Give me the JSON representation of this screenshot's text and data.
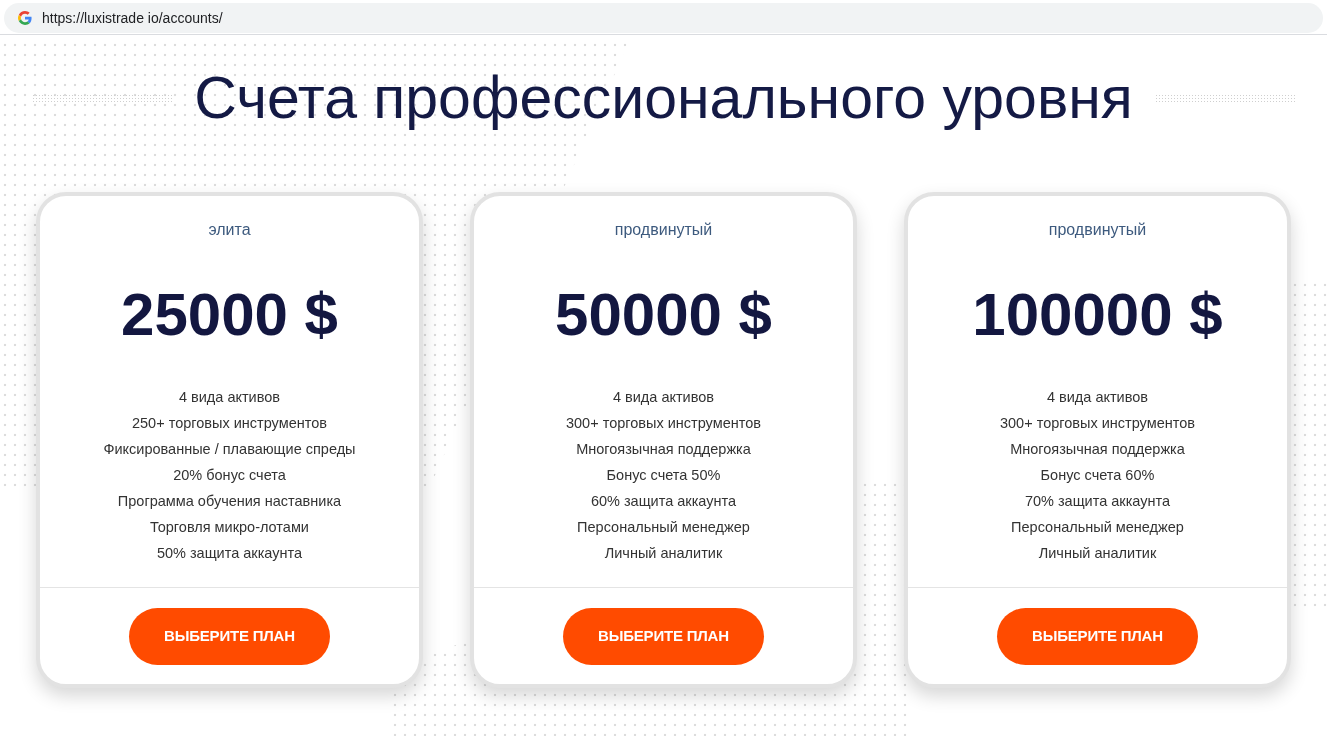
{
  "browser": {
    "url": "https://luxistrade io/accounts/"
  },
  "title": "Счета профессионального уровня",
  "plans": [
    {
      "tier": "элита",
      "price": "25000 $",
      "features": [
        "4 вида активов",
        "250+ торговых инструментов",
        "Фиксированные / плавающие спреды",
        "20% бонус счета",
        "Программа обучения наставника",
        "Торговля микро-лотами",
        "50% защита аккаунта"
      ],
      "button": "ВЫБЕРИТЕ ПЛАН"
    },
    {
      "tier": "продвинутый",
      "price": "50000 $",
      "features": [
        "4 вида активов",
        "300+ торговых инструментов",
        "Многоязычная поддержка",
        "Бонус счета 50%",
        "60% защита аккаунта",
        "Персональный менеджер",
        "Личный аналитик"
      ],
      "button": "ВЫБЕРИТЕ ПЛАН"
    },
    {
      "tier": "продвинутый",
      "price": "100000 $",
      "features": [
        "4 вида активов",
        "300+ торговых инструментов",
        "Многоязычная поддержка",
        "Бонус счета 60%",
        "70% защита аккаунта",
        "Персональный менеджер",
        "Личный аналитик"
      ],
      "button": "ВЫБЕРИТЕ ПЛАН"
    }
  ]
}
